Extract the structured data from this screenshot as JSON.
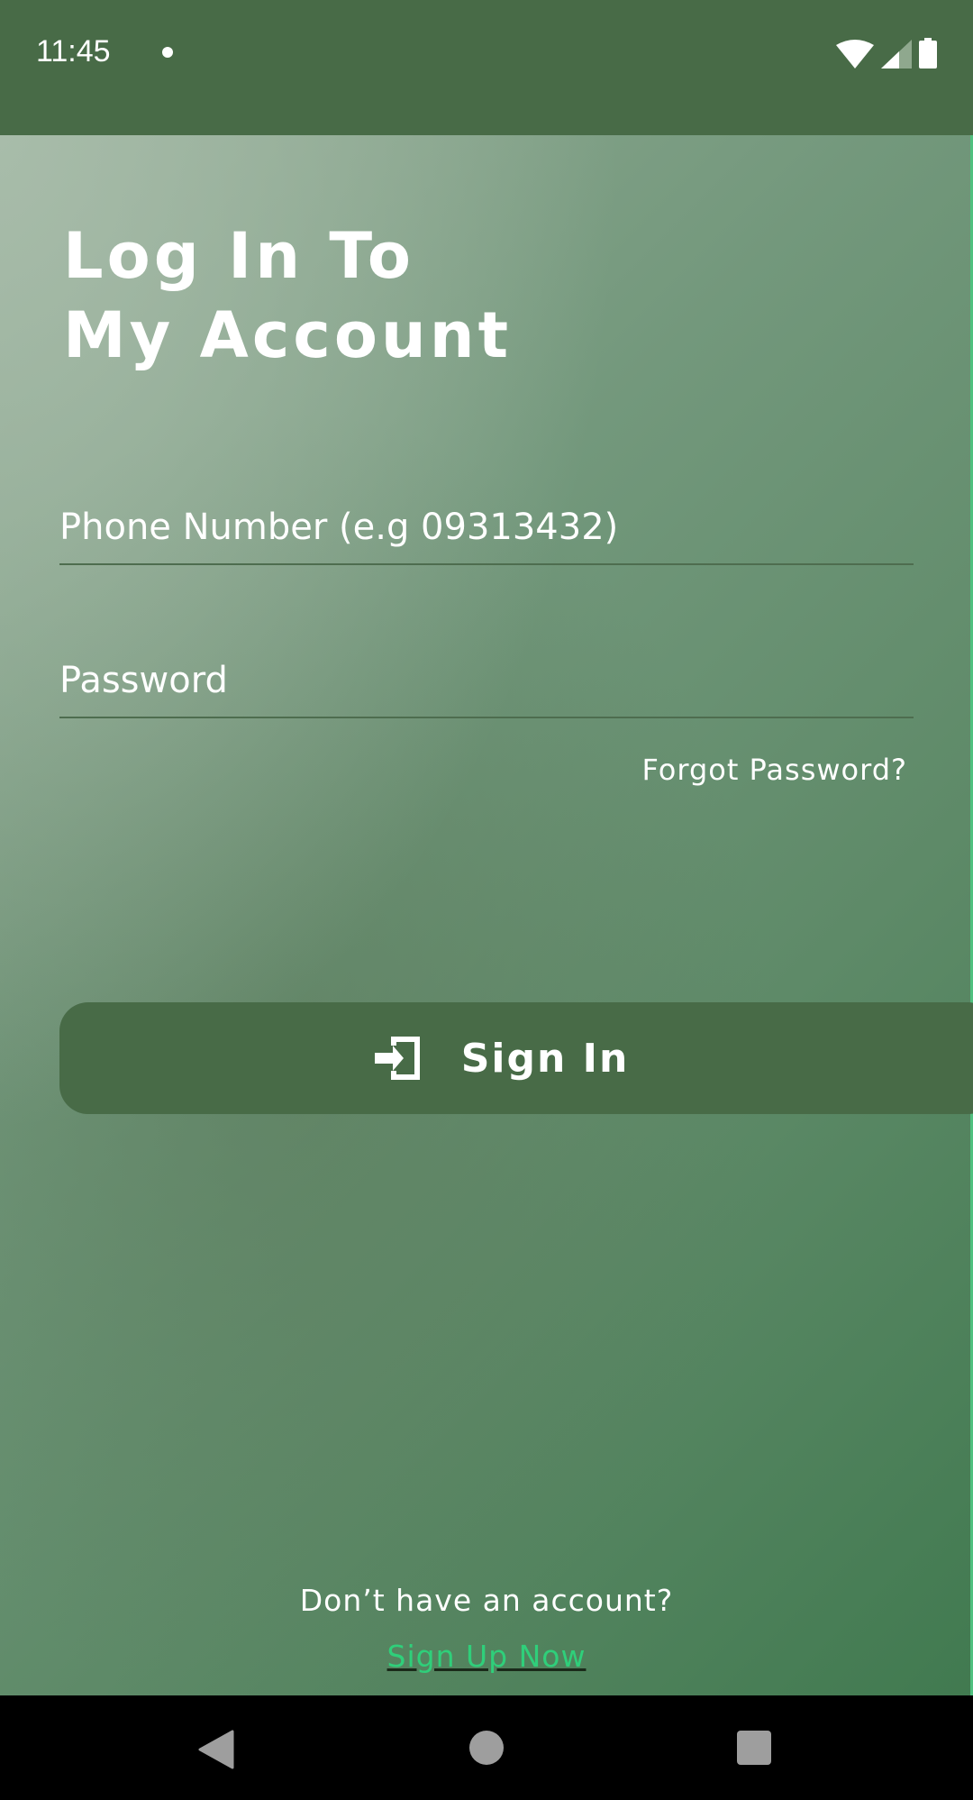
{
  "status_bar": {
    "time": "11:45",
    "icons": [
      "notification-dot-icon",
      "wifi-icon",
      "signal-icon",
      "battery-icon"
    ]
  },
  "login": {
    "title_line1": "Log In To",
    "title_line2": "My Account",
    "phone_placeholder": "Phone Number (e.g 09313432)",
    "password_placeholder": "Password",
    "forgot_password": "Forgot Password?",
    "sign_in_label": "Sign In",
    "sign_in_icon": "login-icon",
    "no_account_text": "Don’t have an account?",
    "sign_up_link": "Sign Up Now"
  },
  "colors": {
    "primary": "#486b47",
    "link": "#2fcf7a"
  },
  "nav_bar": {
    "icons": [
      "back-icon",
      "home-icon",
      "recents-icon"
    ]
  }
}
